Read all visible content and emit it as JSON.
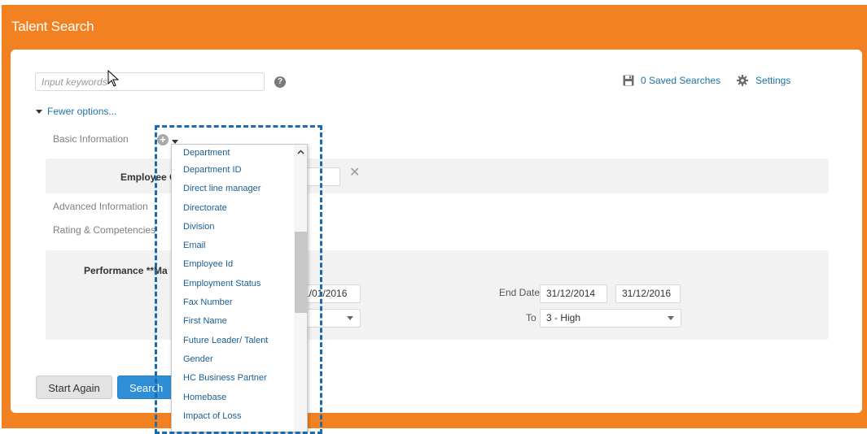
{
  "app": {
    "title": "Talent Search"
  },
  "search": {
    "placeholder": "Input keywords",
    "value": ""
  },
  "toolbar": {
    "saved_label": "0 Saved Searches",
    "settings_label": "Settings"
  },
  "options": {
    "toggle_label": "Fewer options..."
  },
  "sections": {
    "basic": "Basic Information",
    "advanced": "Advanced Information",
    "rating": "Rating & Competencies"
  },
  "employee_row": {
    "label": "Employee C"
  },
  "performance": {
    "label": "Performance **Ma",
    "start_date_to": "1/01/2016",
    "end_date_label": "End Date",
    "end_date_from": "31/12/2014",
    "end_date_to": "31/12/2016",
    "to_label": "To",
    "to_value": "3 - High"
  },
  "buttons": {
    "start_again": "Start Again",
    "search": "Search"
  },
  "dropdown": {
    "items": [
      "Department",
      "Department ID",
      "Direct line manager",
      "Directorate",
      "Division",
      "Email",
      "Employee Id",
      "Employment Status",
      "Fax Number",
      "First Name",
      "Future Leader/ Talent",
      "Gender",
      "HC Business Partner",
      "Homebase",
      "Impact of Loss"
    ]
  },
  "colors": {
    "header": "#f28121",
    "link": "#1a74a8",
    "primary_button": "#2e8fd6",
    "highlight_border": "#1b6bb0"
  }
}
